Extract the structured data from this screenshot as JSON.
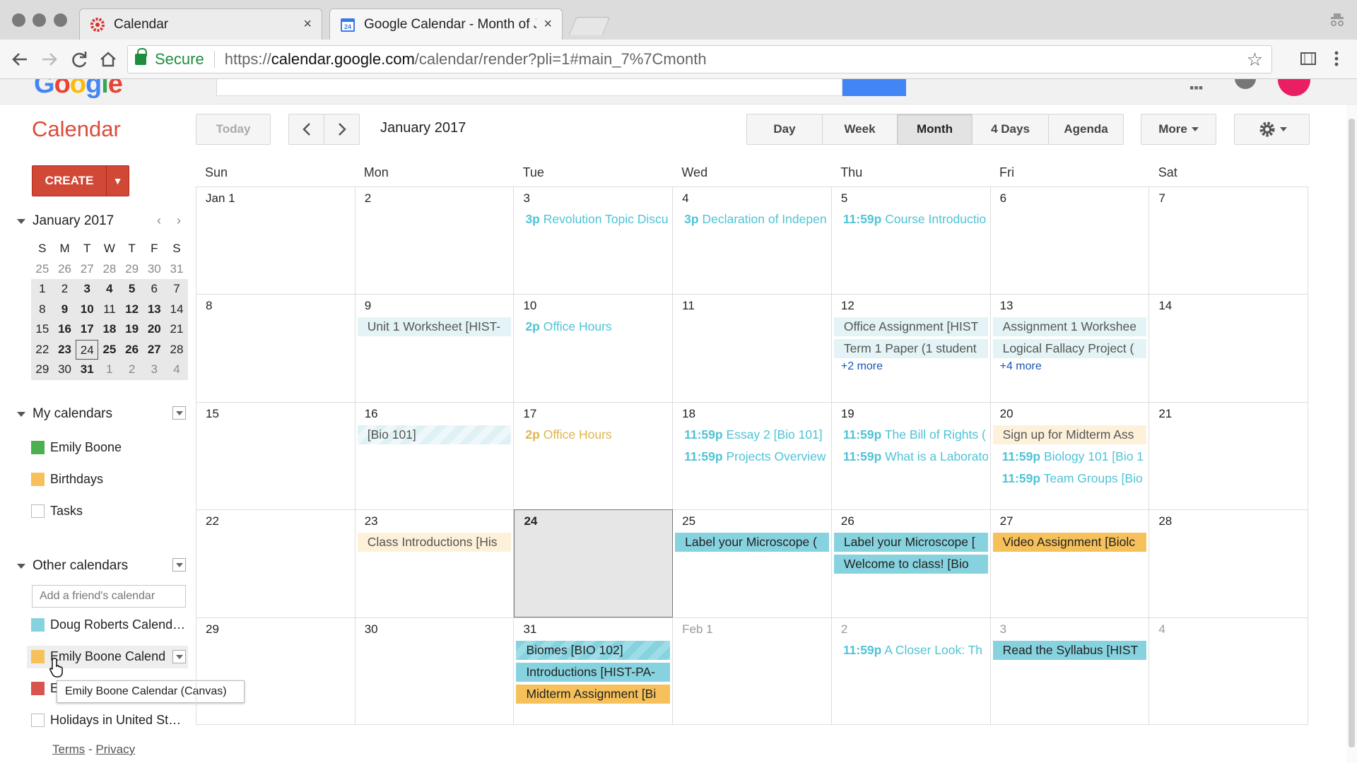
{
  "browser": {
    "tabs": [
      {
        "label": "Calendar",
        "icon": "gear-favicon-icon",
        "active": false
      },
      {
        "label": "Google Calendar - Month of Ja",
        "icon": "calendar-favicon-icon",
        "active": true
      }
    ],
    "close_glyph": "×",
    "secure_label": "Secure",
    "url_scheme": "https://",
    "url_host": "calendar.google.com",
    "url_path": "/calendar/render?pli=1#main_7%7Cmonth"
  },
  "app": {
    "title": "Calendar",
    "today_label": "Today",
    "prev_glyph": "‹",
    "next_glyph": "›",
    "current_month": "January 2017",
    "views": [
      {
        "label": "Day",
        "selected": false
      },
      {
        "label": "Week",
        "selected": false
      },
      {
        "label": "Month",
        "selected": true
      },
      {
        "label": "4 Days",
        "selected": false
      },
      {
        "label": "Agenda",
        "selected": false
      }
    ],
    "more_label": "More",
    "create_label": "CREATE"
  },
  "mini_calendar": {
    "title": "January 2017",
    "dow": [
      "S",
      "M",
      "T",
      "W",
      "T",
      "F",
      "S"
    ],
    "weeks": [
      [
        {
          "d": "25",
          "out": true
        },
        {
          "d": "26",
          "out": true
        },
        {
          "d": "27",
          "out": true
        },
        {
          "d": "28",
          "out": true
        },
        {
          "d": "29",
          "out": true
        },
        {
          "d": "30",
          "out": true
        },
        {
          "d": "31",
          "out": true
        }
      ],
      [
        {
          "d": "1",
          "bold": false
        },
        {
          "d": "2"
        },
        {
          "d": "3",
          "bold": true
        },
        {
          "d": "4",
          "bold": true
        },
        {
          "d": "5",
          "bold": true
        },
        {
          "d": "6"
        },
        {
          "d": "7"
        }
      ],
      [
        {
          "d": "8"
        },
        {
          "d": "9",
          "bold": true
        },
        {
          "d": "10",
          "bold": true
        },
        {
          "d": "11"
        },
        {
          "d": "12",
          "bold": true
        },
        {
          "d": "13",
          "bold": true
        },
        {
          "d": "14"
        }
      ],
      [
        {
          "d": "15"
        },
        {
          "d": "16",
          "bold": true
        },
        {
          "d": "17",
          "bold": true
        },
        {
          "d": "18",
          "bold": true
        },
        {
          "d": "19",
          "bold": true
        },
        {
          "d": "20",
          "bold": true
        },
        {
          "d": "21"
        }
      ],
      [
        {
          "d": "22"
        },
        {
          "d": "23",
          "bold": true
        },
        {
          "d": "24",
          "today": true
        },
        {
          "d": "25",
          "bold": true
        },
        {
          "d": "26",
          "bold": true
        },
        {
          "d": "27",
          "bold": true
        },
        {
          "d": "28"
        }
      ],
      [
        {
          "d": "29"
        },
        {
          "d": "30"
        },
        {
          "d": "31",
          "bold": true
        },
        {
          "d": "1",
          "out": true
        },
        {
          "d": "2",
          "out": true
        },
        {
          "d": "3",
          "out": true
        },
        {
          "d": "4",
          "out": true
        }
      ]
    ]
  },
  "my_calendars": {
    "title": "My calendars",
    "items": [
      {
        "label": "Emily Boone",
        "color": "#4caf50"
      },
      {
        "label": "Birthdays",
        "color": "#f6c15a"
      },
      {
        "label": "Tasks",
        "color": ""
      }
    ]
  },
  "other_calendars": {
    "title": "Other calendars",
    "add_placeholder": "Add a friend's calendar",
    "items": [
      {
        "label": "Doug Roberts Calend…",
        "color": "#86d3df"
      },
      {
        "label": "Emily Boone Calend",
        "color": "#f6c15a"
      },
      {
        "label": "E",
        "color": "#d9534f"
      },
      {
        "label": "Holidays in United St…",
        "color": ""
      }
    ],
    "tooltip": "Emily Boone Calendar (Canvas)"
  },
  "footer": {
    "terms": "Terms",
    "sep": " - ",
    "privacy": "Privacy"
  },
  "month_grid": {
    "dow": [
      "Sun",
      "Mon",
      "Tue",
      "Wed",
      "Thu",
      "Fri",
      "Sat"
    ],
    "weeks": [
      [
        {
          "date": "Jan 1",
          "events": []
        },
        {
          "date": "2",
          "events": []
        },
        {
          "date": "3",
          "events": [
            {
              "time": "3p",
              "title": "Revolution Topic Discu",
              "style": "plain-cyan"
            }
          ]
        },
        {
          "date": "4",
          "events": [
            {
              "time": "3p",
              "title": "Declaration of Indepen",
              "style": "plain-cyan"
            }
          ]
        },
        {
          "date": "5",
          "events": [
            {
              "time": "11:59p",
              "title": "Course Introductio",
              "style": "plain-cyan"
            }
          ]
        },
        {
          "date": "6",
          "events": []
        },
        {
          "date": "7",
          "events": []
        }
      ],
      [
        {
          "date": "8",
          "events": []
        },
        {
          "date": "9",
          "events": [
            {
              "time": "",
              "title": "Unit 1 Worksheet [HIST-",
              "style": "pale"
            }
          ]
        },
        {
          "date": "10",
          "events": [
            {
              "time": "2p",
              "title": "Office Hours",
              "style": "plain-cyan"
            }
          ]
        },
        {
          "date": "11",
          "events": []
        },
        {
          "date": "12",
          "events": [
            {
              "time": "",
              "title": "Office Assignment [HIST",
              "style": "pale"
            },
            {
              "time": "",
              "title": "Term 1 Paper (1 student",
              "style": "pale"
            }
          ],
          "more": "+2 more"
        },
        {
          "date": "13",
          "events": [
            {
              "time": "",
              "title": "Assignment 1 Workshee",
              "style": "pale"
            },
            {
              "time": "",
              "title": "Logical Fallacy Project (",
              "style": "pale"
            }
          ],
          "more": "+4 more"
        },
        {
          "date": "14",
          "events": []
        }
      ],
      [
        {
          "date": "15",
          "events": []
        },
        {
          "date": "16",
          "events": [
            {
              "time": "",
              "title": "[Bio 101]",
              "style": "striped"
            }
          ]
        },
        {
          "date": "17",
          "events": [
            {
              "time": "2p",
              "title": "Office Hours",
              "style": "plain-gold"
            }
          ]
        },
        {
          "date": "18",
          "events": [
            {
              "time": "11:59p",
              "title": "Essay 2 [Bio 101]",
              "style": "plain-cyan"
            },
            {
              "time": "11:59p",
              "title": "Projects Overview",
              "style": "plain-cyan"
            }
          ]
        },
        {
          "date": "19",
          "events": [
            {
              "time": "11:59p",
              "title": "The Bill of Rights (",
              "style": "plain-cyan"
            },
            {
              "time": "11:59p",
              "title": "What is a Laborato",
              "style": "plain-cyan"
            }
          ]
        },
        {
          "date": "20",
          "events": [
            {
              "time": "",
              "title": "Sign up for Midterm Ass",
              "style": "pale-gold"
            },
            {
              "time": "11:59p",
              "title": "Biology 101 [Bio 1",
              "style": "plain-cyan"
            },
            {
              "time": "11:59p",
              "title": "Team Groups [Bio",
              "style": "plain-cyan"
            }
          ]
        },
        {
          "date": "21",
          "events": []
        }
      ],
      [
        {
          "date": "22",
          "events": []
        },
        {
          "date": "23",
          "events": [
            {
              "time": "",
              "title": "Class Introductions [His",
              "style": "pale-gold"
            }
          ]
        },
        {
          "date": "24",
          "today": true,
          "events": []
        },
        {
          "date": "25",
          "events": [
            {
              "time": "",
              "title": "Label your Microscope (",
              "style": "solid-cyan"
            }
          ]
        },
        {
          "date": "26",
          "events": [
            {
              "time": "",
              "title": "Label your Microscope [",
              "style": "solid-cyan"
            },
            {
              "time": "",
              "title": "Welcome to class! [Bio ",
              "style": "solid-cyan"
            }
          ]
        },
        {
          "date": "27",
          "events": [
            {
              "time": "",
              "title": "Video Assignment [Biolc",
              "style": "solid-gold"
            }
          ]
        },
        {
          "date": "28",
          "events": []
        }
      ],
      [
        {
          "date": "29",
          "events": []
        },
        {
          "date": "30",
          "events": []
        },
        {
          "date": "31",
          "events": [
            {
              "time": "",
              "title": "Biomes [BIO 102]",
              "style": "striped-solid"
            },
            {
              "time": "",
              "title": "Introductions [HIST-PA-",
              "style": "solid-cyan"
            },
            {
              "time": "",
              "title": "Midterm Assignment [Bi",
              "style": "solid-gold"
            }
          ]
        },
        {
          "date": "Feb 1",
          "out": true,
          "events": []
        },
        {
          "date": "2",
          "out": true,
          "events": [
            {
              "time": "11:59p",
              "title": "A Closer Look: Th",
              "style": "plain-cyan"
            }
          ]
        },
        {
          "date": "3",
          "out": true,
          "events": [
            {
              "time": "",
              "title": "Read the Syllabus [HIST",
              "style": "solid-cyan"
            }
          ]
        },
        {
          "date": "4",
          "out": true,
          "events": []
        }
      ]
    ]
  }
}
